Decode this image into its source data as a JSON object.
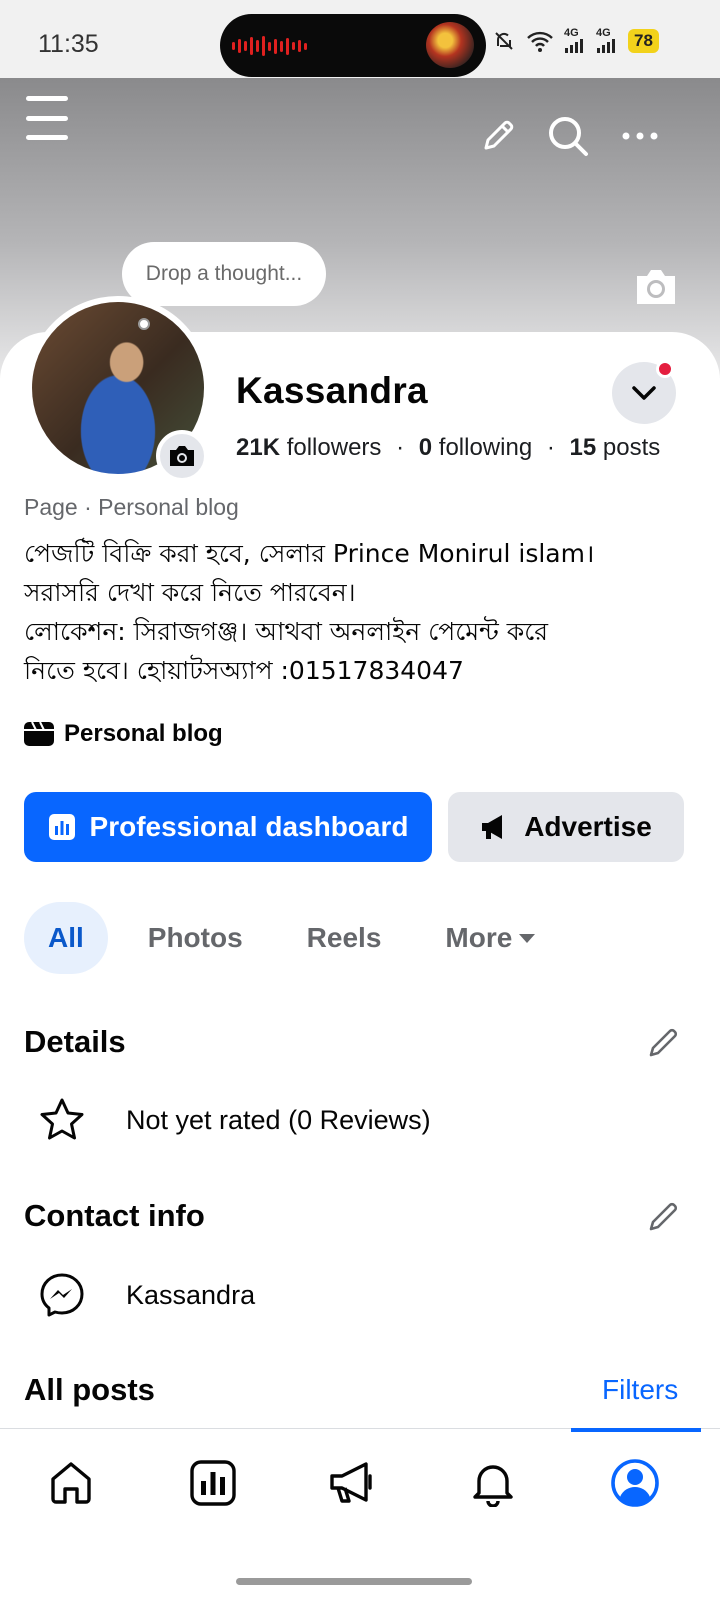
{
  "status_bar": {
    "time": "11:35",
    "network1": "4G",
    "network2": "4G",
    "battery": "78",
    "icons": [
      "audio-wave-icon",
      "media-thumbnail",
      "bell-muted-icon",
      "wifi-icon",
      "signal-icon",
      "signal-icon",
      "battery-icon"
    ]
  },
  "cover": {
    "thought_placeholder": "Drop a thought...",
    "icons": [
      "menu-icon",
      "edit-icon",
      "search-icon",
      "more-icon",
      "camera-icon"
    ]
  },
  "profile": {
    "name": "Kassandra",
    "followers_count": "21K",
    "followers_label": "followers",
    "following_count": "0",
    "following_label": "following",
    "posts_count": "15",
    "posts_label": "posts",
    "separator": "·",
    "category_line": "Page · Personal blog",
    "bio_lines": [
      "পেজটি বিক্রি করা হবে, সেলার Prince Monirul islam।",
      "সরাসরি দেখা করে নিতে পারবেন।",
      "লোকেশন: সিরাজগঞ্জ। আথবা অনলাইন পেমেন্ট করে",
      "নিতে হবে। হোয়াটসঅ্যাপ :01517834047"
    ],
    "tag_label": "Personal blog"
  },
  "actions": {
    "dashboard_label": "Professional dashboard",
    "advertise_label": "Advertise"
  },
  "tabs": [
    {
      "label": "All",
      "active": true
    },
    {
      "label": "Photos",
      "active": false
    },
    {
      "label": "Reels",
      "active": false
    },
    {
      "label": "More",
      "active": false
    }
  ],
  "details": {
    "title": "Details",
    "rating_text": "Not yet rated (0 Reviews)"
  },
  "contact": {
    "title": "Contact info",
    "messenger_name": "Kassandra"
  },
  "posts": {
    "title": "All posts",
    "filters_label": "Filters"
  },
  "colors": {
    "primary": "#0866ff",
    "notification_dot": "#e41e3f",
    "tab_active_bg": "#e7f0fd",
    "battery": "#f2d21b"
  },
  "bottom_nav": [
    "home-icon",
    "dashboard-icon",
    "megaphone-icon",
    "bell-icon",
    "profile-icon"
  ]
}
